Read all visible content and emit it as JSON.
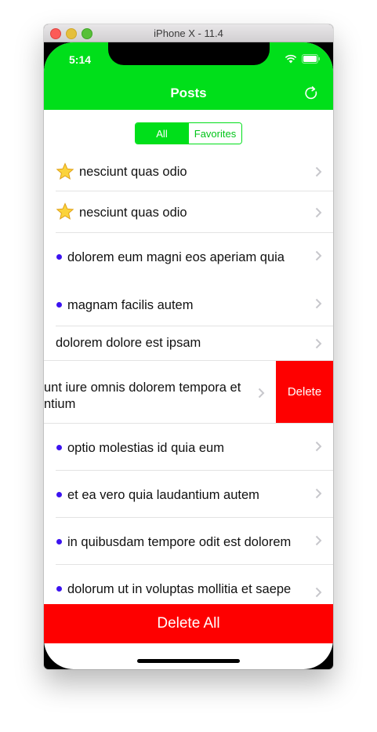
{
  "window": {
    "title": "iPhone X - 11.4"
  },
  "status_bar": {
    "time": "5:14"
  },
  "navbar": {
    "title": "Posts",
    "refresh_icon": "refresh-icon",
    "color": "#00df1a"
  },
  "segmented": {
    "options": [
      "All",
      "Favorites"
    ],
    "selected": "All"
  },
  "posts": [
    {
      "title": "nesciunt quas odio",
      "marker": "star"
    },
    {
      "title": "nesciunt quas odio",
      "marker": "star"
    },
    {
      "title": "dolorem eum magni eos aperiam quia",
      "marker": "dot"
    },
    {
      "title": "magnam facilis autem",
      "marker": "dot"
    },
    {
      "title": "dolorem dolore est ipsam",
      "marker": "none"
    },
    {
      "title_line1": "unt iure omnis dolorem tempora et",
      "title_line2": "ntium",
      "marker": "none",
      "swiped": true
    },
    {
      "title": "optio molestias id quia eum",
      "marker": "dot"
    },
    {
      "title": "et ea vero quia laudantium autem",
      "marker": "dot"
    },
    {
      "title": "in quibusdam tempore odit est dolorem",
      "marker": "dot"
    },
    {
      "title": "dolorum ut in voluptas mollitia et saepe",
      "marker": "dot"
    }
  ],
  "swipe_action": {
    "label": "Delete",
    "color": "#fe0000"
  },
  "footer": {
    "delete_all_label": "Delete All",
    "color": "#fe0000"
  },
  "colors": {
    "unread_dot": "#3c13f0"
  }
}
